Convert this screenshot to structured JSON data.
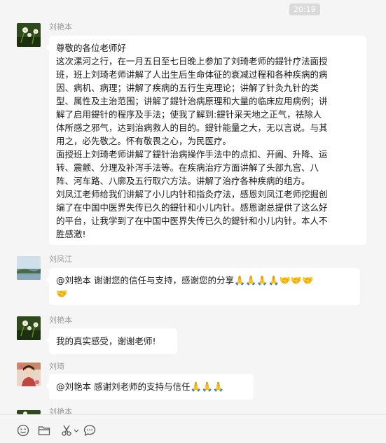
{
  "timestamp": "20:19",
  "messages": [
    {
      "sender": "刘艳本",
      "lines": [
        "尊敬的各位老师好",
        "这次漯河之行，在一月五日至七日晚上参加了刘琦老师的鍉针疗法面授",
        "班，班上刘琦老师讲解了人出生后生命体征的衰减过程和各种疾病的病",
        "因、病机、病理；讲解了疾病的五行生克理论；讲解了针灸九针的类",
        "型、属性及主治范围；讲解了鍉针治病原理和大量的临床应用病例；讲",
        "解了启用鍉针的程序及手法；使我了解到:鍉针采天地之正气，祛除人",
        "体所感之邪气，达到治病救人的目的。鍉针能量之大，无以言说。与其",
        "用之，必先敬之。怀有敬畏之心，为民医疗。",
        "面授班上刘琦老师讲解了鍉针治病操作手法中的点扣、开阖、升降、运",
        "转、震颤、分理及补泻手法等。在疾病治疗方面讲解了头部九宫、八",
        "阵、河车路、八廓及五行取穴方法。讲解了治疗各种疾病的组方。",
        "刘凤江老师给我们讲解了小儿内针和指灸疗法，感恩刘凤江老师挖掘创",
        "编了在中国中医界失传已久的鍉针和小儿内针。感恩谢总提供了这么好",
        "的平台，让我学到了在中国中医界失传已久的鍉针和小儿内针。本人不",
        "胜感激!"
      ]
    },
    {
      "sender": "刘凤江",
      "text": "@刘艳本 谢谢您的信任与支持，感谢您的分享",
      "emojis": [
        "🙏",
        "🙏",
        "🙏",
        "🙏",
        "🤝",
        "🤝",
        "🤝"
      ],
      "emojis_line2": [
        "🤝"
      ]
    },
    {
      "sender": "刘艳本",
      "text": "我的真实感受，谢谢老师!"
    },
    {
      "sender": "刘琦",
      "text": "@刘艳本 感谢刘老师的支持与信任",
      "emojis": [
        "🙏",
        "🙏",
        "🙏"
      ]
    },
    {
      "sender": "刘艳本"
    }
  ],
  "colors": {
    "background": "#f5f5f5",
    "bubble": "#ffffff",
    "sender_text": "#9a9a9a",
    "timestamp_bg": "#dadada"
  },
  "toolbar_icons": [
    "emoji-icon",
    "folder-icon",
    "scissors-icon",
    "chat-bubble-icon"
  ]
}
